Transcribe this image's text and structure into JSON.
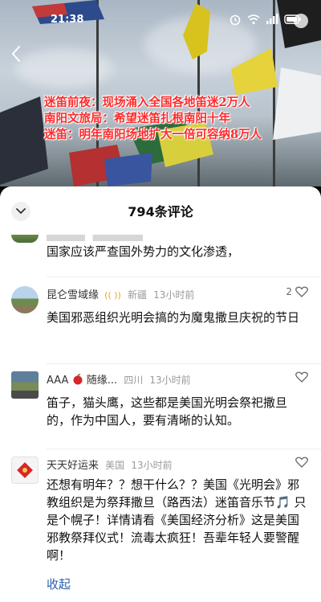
{
  "status_bar": {
    "time": "21:38"
  },
  "video": {
    "overlay_lines": [
      "迷笛前夜：现场涌入全国各地笛迷2万人",
      "南阳文旅局：希望迷笛扎根南阳十年",
      "迷笛：明年南阳场地扩大一倍可容纳8万人"
    ]
  },
  "comments_panel": {
    "count_label": "794条评论",
    "comments": [
      {
        "body": "国家应该严查国外势力的文化渗透，"
      },
      {
        "username": "昆仑雪域缘",
        "badge": "(( ))",
        "location": "新疆",
        "time": "13小时前",
        "likes": "2",
        "body": "美国邪恶组织光明会搞的为魔鬼撒旦庆祝的节日"
      },
      {
        "username": "AAA",
        "username_suffix": "随缘...",
        "location": "四川",
        "time": "13小时前",
        "body": "笛子，猫头鹰，这些都是美国光明会祭祀撒旦的，作为中国人，要有清晰的认知。"
      },
      {
        "username": "天天好运来",
        "location": "美国",
        "time": "13小时前",
        "body": "还想有明年？？想干什么？？美国《光明会》邪教组织是为祭拜撒旦（路西法）迷笛音乐节🎵 只是个幌子！详情请看《美国经济分析》这是美国邪教祭拜仪式！流毒太疯狂！吾辈年轻人要警醒啊！"
      }
    ],
    "fold_label": "收起"
  }
}
